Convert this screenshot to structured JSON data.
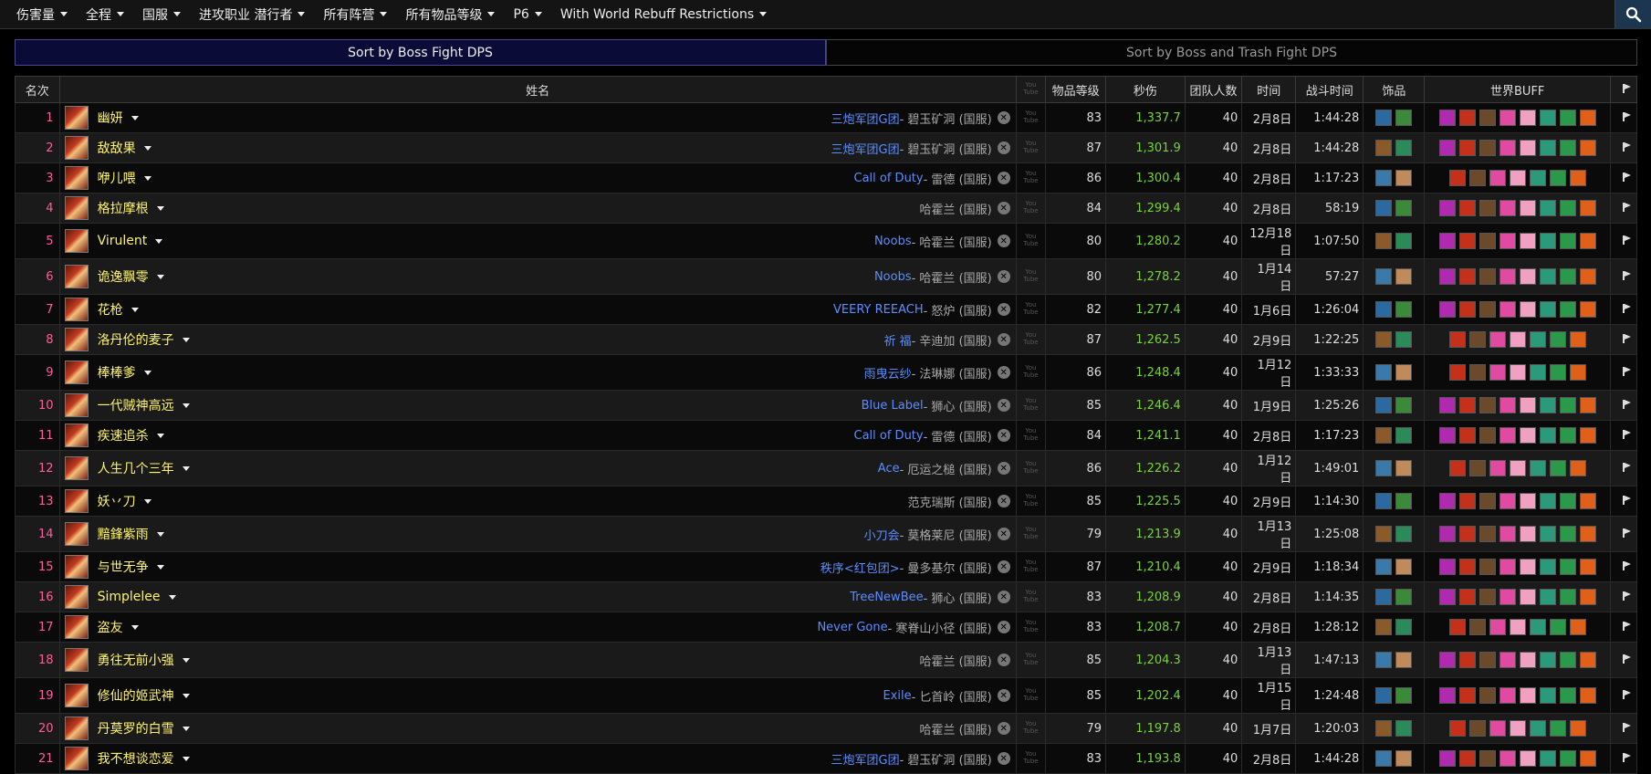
{
  "menu": [
    {
      "label": "伤害量",
      "icon": "caret-down-icon"
    },
    {
      "label": "全程",
      "icon": "caret-down-icon"
    },
    {
      "label": "国服",
      "icon": "caret-down-icon"
    },
    {
      "label": "进攻职业 潜行者",
      "icon": "caret-down-icon"
    },
    {
      "label": "所有阵营",
      "icon": "caret-down-icon"
    },
    {
      "label": "所有物品等级",
      "icon": "caret-down-icon"
    },
    {
      "label": "P6",
      "icon": "caret-down-icon"
    },
    {
      "label": "With World Rebuff Restrictions",
      "icon": "caret-down-icon"
    }
  ],
  "search_icon": "search-icon",
  "sort_tabs": [
    {
      "label": "Sort by Boss Fight DPS",
      "active": true
    },
    {
      "label": "Sort by Boss and Trash Fight DPS",
      "active": false
    }
  ],
  "columns": {
    "rank": "名次",
    "name": "姓名",
    "ilvl": "物品等级",
    "dps": "秒伤",
    "size": "团队人数",
    "date": "时间",
    "duration": "战斗时间",
    "trinkets": "饰品",
    "buffs": "世界BUFF",
    "youtube_icon": "youtube-icon",
    "flag_icon": "flag-icon"
  },
  "colors": {
    "rank": "#ff5c9b",
    "name": "#fff569",
    "guild": "#5c8dff",
    "dps": "#7bd13c",
    "active_tab": "#0b0b38"
  },
  "rows": [
    {
      "rank": "1",
      "name": "幽妍",
      "guild": "三炮军团G团",
      "server": " - 碧玉矿洞 (国服)",
      "ilvl": "83",
      "dps": "1,337.7",
      "size": "40",
      "date": "2月8日",
      "duration": "1:44:28",
      "buffs": 8
    },
    {
      "rank": "2",
      "name": "敌敌果",
      "guild": "三炮军团G团",
      "server": " - 碧玉矿洞 (国服)",
      "ilvl": "87",
      "dps": "1,301.9",
      "size": "40",
      "date": "2月8日",
      "duration": "1:44:28",
      "buffs": 8
    },
    {
      "rank": "3",
      "name": "咿儿喂",
      "guild": "Call of Duty",
      "server": " - 雷德 (国服)",
      "ilvl": "86",
      "dps": "1,300.4",
      "size": "40",
      "date": "2月8日",
      "duration": "1:17:23",
      "buffs": 7
    },
    {
      "rank": "4",
      "name": "格拉摩根",
      "guild": "",
      "server": "哈霍兰 (国服)",
      "ilvl": "84",
      "dps": "1,299.4",
      "size": "40",
      "date": "2月8日",
      "duration": "58:19",
      "buffs": 8
    },
    {
      "rank": "5",
      "name": "Virulent",
      "guild": "Noobs",
      "server": " - 哈霍兰 (国服)",
      "ilvl": "80",
      "dps": "1,280.2",
      "size": "40",
      "date": "12月18日",
      "duration": "1:07:50",
      "buffs": 8
    },
    {
      "rank": "6",
      "name": "诡逸飘零",
      "guild": "Noobs",
      "server": " - 哈霍兰 (国服)",
      "ilvl": "80",
      "dps": "1,278.2",
      "size": "40",
      "date": "1月14日",
      "duration": "57:27",
      "buffs": 8
    },
    {
      "rank": "7",
      "name": "花枪",
      "guild": "VEERY REEACH",
      "server": " - 怒炉 (国服)",
      "ilvl": "82",
      "dps": "1,277.4",
      "size": "40",
      "date": "1月6日",
      "duration": "1:26:04",
      "buffs": 8
    },
    {
      "rank": "8",
      "name": "洛丹伦的麦子",
      "guild": "祈 福",
      "server": " - 辛迪加 (国服)",
      "ilvl": "87",
      "dps": "1,262.5",
      "size": "40",
      "date": "2月9日",
      "duration": "1:22:25",
      "buffs": 7
    },
    {
      "rank": "9",
      "name": "棒棒爹",
      "guild": "雨曳云纱",
      "server": " - 法琳娜 (国服)",
      "ilvl": "86",
      "dps": "1,248.4",
      "size": "40",
      "date": "1月12日",
      "duration": "1:33:33",
      "buffs": 7
    },
    {
      "rank": "10",
      "name": "一代贼神高远",
      "guild": "Blue Label",
      "server": " - 狮心 (国服)",
      "ilvl": "85",
      "dps": "1,246.4",
      "size": "40",
      "date": "1月9日",
      "duration": "1:25:26",
      "buffs": 8
    },
    {
      "rank": "11",
      "name": "疾速追杀",
      "guild": "Call of Duty",
      "server": " - 雷德 (国服)",
      "ilvl": "84",
      "dps": "1,241.1",
      "size": "40",
      "date": "2月8日",
      "duration": "1:17:23",
      "buffs": 8
    },
    {
      "rank": "12",
      "name": "人生几个三年",
      "guild": "Ace",
      "server": " - 厄运之槌 (国服)",
      "ilvl": "86",
      "dps": "1,226.2",
      "size": "40",
      "date": "1月12日",
      "duration": "1:49:01",
      "buffs": 7
    },
    {
      "rank": "13",
      "name": "妖丷刀",
      "guild": "",
      "server": "范克瑞斯 (国服)",
      "ilvl": "85",
      "dps": "1,225.5",
      "size": "40",
      "date": "2月9日",
      "duration": "1:14:30",
      "buffs": 8
    },
    {
      "rank": "14",
      "name": "黯鋒紫雨",
      "guild": "小刀会",
      "server": " - 莫格莱尼 (国服)",
      "ilvl": "79",
      "dps": "1,213.9",
      "size": "40",
      "date": "1月13日",
      "duration": "1:25:08",
      "buffs": 8
    },
    {
      "rank": "15",
      "name": "与世无争",
      "guild": "秩序<红包团>",
      "server": " - 曼多基尔 (国服)",
      "ilvl": "87",
      "dps": "1,210.4",
      "size": "40",
      "date": "2月9日",
      "duration": "1:18:34",
      "buffs": 8
    },
    {
      "rank": "16",
      "name": "Simplelee",
      "guild": "TreeNewBee",
      "server": " - 狮心 (国服)",
      "ilvl": "83",
      "dps": "1,208.9",
      "size": "40",
      "date": "2月8日",
      "duration": "1:14:35",
      "buffs": 8
    },
    {
      "rank": "17",
      "name": "盗友",
      "guild": "Never Gone",
      "server": " - 寒脊山小径 (国服)",
      "ilvl": "83",
      "dps": "1,208.7",
      "size": "40",
      "date": "2月8日",
      "duration": "1:28:12",
      "buffs": 7
    },
    {
      "rank": "18",
      "name": "勇往无前小强",
      "guild": "",
      "server": "哈霍兰 (国服)",
      "ilvl": "85",
      "dps": "1,204.3",
      "size": "40",
      "date": "1月13日",
      "duration": "1:47:13",
      "buffs": 8
    },
    {
      "rank": "19",
      "name": "修仙的姬武神",
      "guild": "Exile",
      "server": " - 匕首岭 (国服)",
      "ilvl": "85",
      "dps": "1,202.4",
      "size": "40",
      "date": "1月15日",
      "duration": "1:24:48",
      "buffs": 8
    },
    {
      "rank": "20",
      "name": "丹莫罗的白雪",
      "guild": "",
      "server": "哈霍兰 (国服)",
      "ilvl": "79",
      "dps": "1,197.8",
      "size": "40",
      "date": "1月7日",
      "duration": "1:20:03",
      "buffs": 7
    },
    {
      "rank": "21",
      "name": "我不想谈恋爱",
      "guild": "三炮军团G团",
      "server": " - 碧玉矿洞 (国服)",
      "ilvl": "83",
      "dps": "1,193.8",
      "size": "40",
      "date": "2月8日",
      "duration": "1:44:28",
      "buffs": 8
    }
  ]
}
